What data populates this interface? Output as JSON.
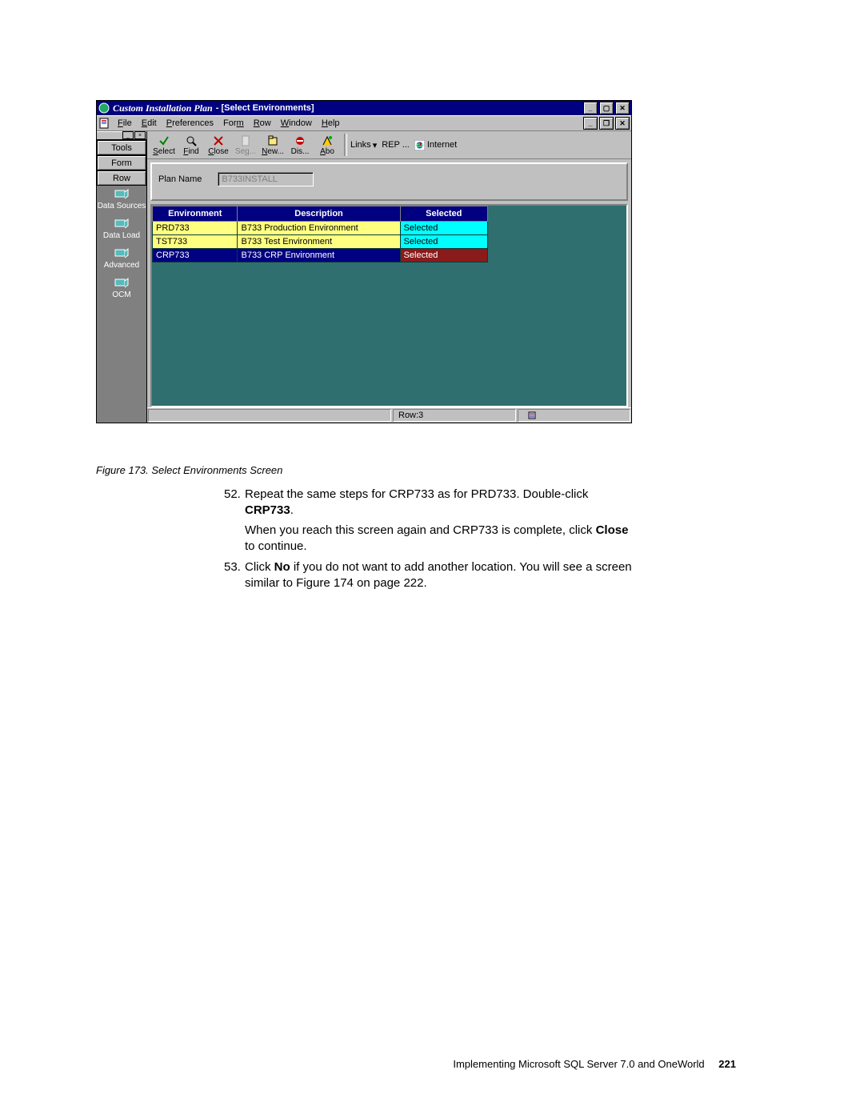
{
  "window": {
    "app_title": "Custom Installation Plan",
    "sub_title": " - [Select Environments]"
  },
  "menu": {
    "items": [
      {
        "u": "F",
        "rest": "ile"
      },
      {
        "u": "E",
        "rest": "dit"
      },
      {
        "u": "P",
        "rest": "references"
      },
      {
        "u": "",
        "rest": "Form",
        "u2": "m"
      },
      {
        "u": "R",
        "rest": "ow"
      },
      {
        "u": "W",
        "rest": "indow"
      },
      {
        "u": "H",
        "rest": "elp"
      }
    ]
  },
  "sidebar": {
    "buttons": [
      "Tools",
      "Form",
      "Row"
    ],
    "items": [
      "Data Sources",
      "Data Load",
      "Advanced",
      "OCM"
    ]
  },
  "toolbar": {
    "buttons": [
      {
        "u": "S",
        "rest": "elect",
        "color": "#008000",
        "glyph": "check"
      },
      {
        "u": "F",
        "rest": "ind",
        "color": "#000",
        "glyph": "find"
      },
      {
        "u": "C",
        "rest": "lose",
        "color": "#c00000",
        "glyph": "x"
      },
      {
        "u": "",
        "rest": "Seq...",
        "disabled": true,
        "glyph": "seq"
      },
      {
        "u": "N",
        "rest": "ew...",
        "color": "#000",
        "glyph": "new"
      },
      {
        "u": "",
        "rest": "Dis...",
        "glyph": "dis"
      },
      {
        "u": "A",
        "rest": "bo",
        "glyph": "abo"
      }
    ],
    "links_label": "Links",
    "rep_label": "REP ...",
    "internet_label": "Internet"
  },
  "panel": {
    "plan_label": "Plan Name",
    "plan_value": "B733INSTALL"
  },
  "grid": {
    "headers": [
      "Environment",
      "Description",
      "Selected"
    ],
    "rows": [
      {
        "env": "PRD733",
        "desc": "B733 Production Environment",
        "sel": "Selected",
        "style": "yellow",
        "dotted": true
      },
      {
        "env": "TST733",
        "desc": "B733 Test Environment",
        "sel": "Selected",
        "style": "yellow"
      },
      {
        "env": "CRP733",
        "desc": "B733 CRP Environment",
        "sel": "Selected",
        "style": "selected"
      }
    ]
  },
  "status": {
    "row": "Row:3"
  },
  "caption": "Figure 173.  Select Environments Screen",
  "step52_num": "52.",
  "step52a": "Repeat the same steps for CRP733 as for PRD733. Double-click ",
  "step52a_bold": "CRP733",
  "step52a_end": ".",
  "step52b_a": "When you reach this screen again and CRP733 is complete, click ",
  "step52b_bold": "Close",
  "step52b_b": " to continue.",
  "step53_num": "53.",
  "step53a": "Click ",
  "step53_bold": "No",
  "step53b": " if you do not want to add another location. You will see a screen similar to Figure 174 on page 222.",
  "footer_text": "Implementing Microsoft SQL Server 7.0 and OneWorld",
  "footer_page": "221"
}
